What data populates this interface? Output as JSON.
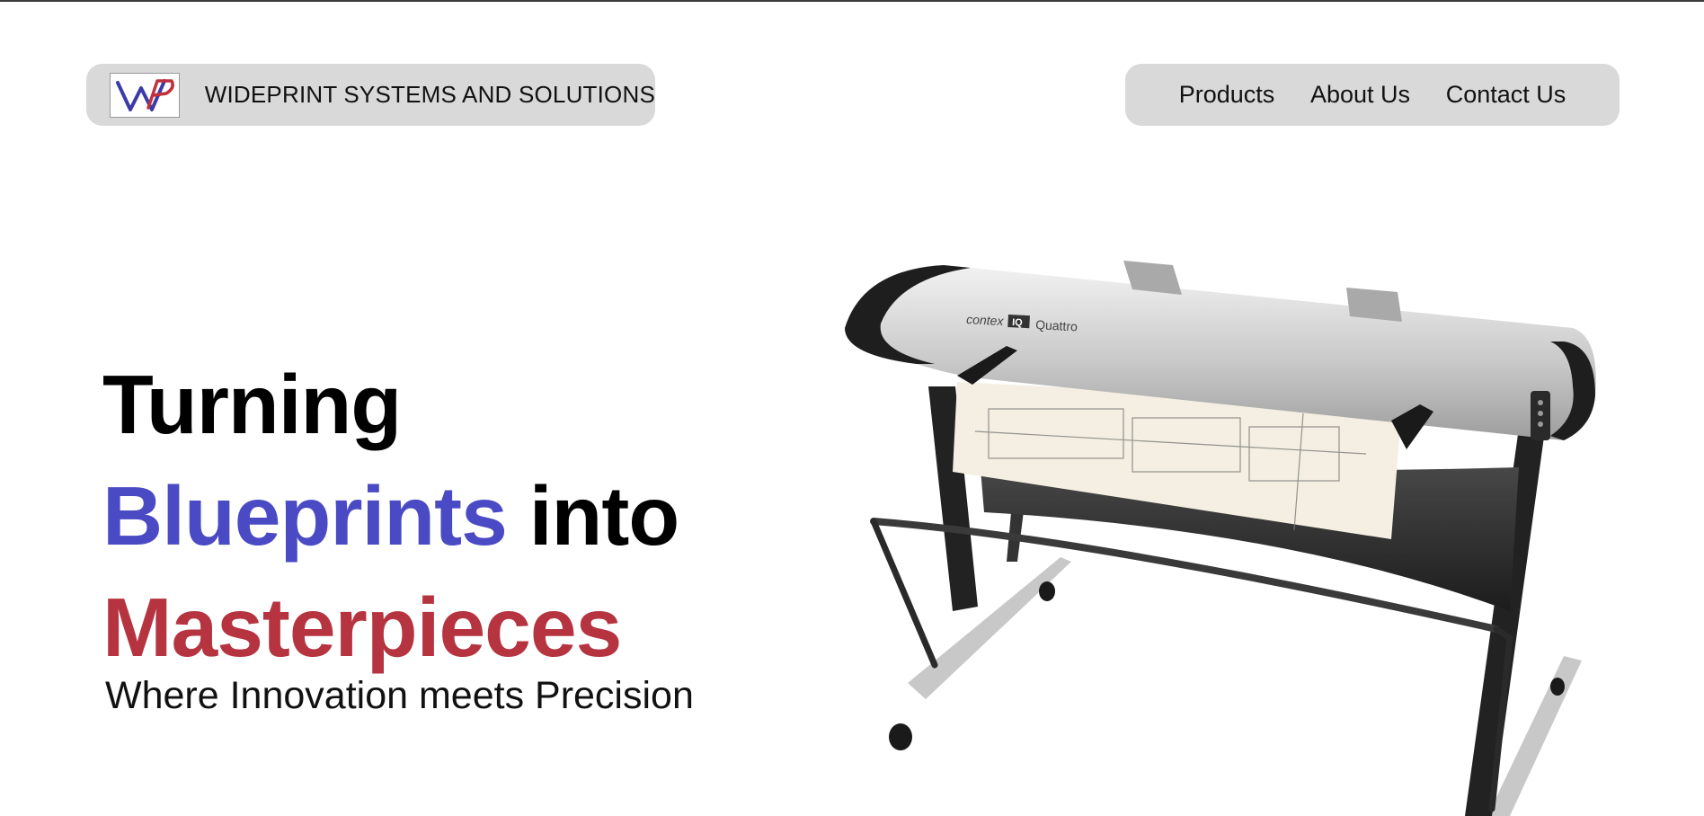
{
  "header": {
    "logo_text": "WP",
    "brand_name": "WIDEPRINT SYSTEMS AND SOLUTIONS",
    "nav": [
      {
        "label": "Products"
      },
      {
        "label": "About Us"
      },
      {
        "label": "Contact Us"
      }
    ]
  },
  "hero": {
    "line1": "Turning",
    "line2_blue": "Blueprints",
    "line2_rest": "into",
    "line3": "Masterpieces",
    "subtitle": "Where Innovation meets Precision"
  },
  "product_image": {
    "brand_text": "contex",
    "model_badge": "IQ",
    "model_name": "Quattro"
  },
  "colors": {
    "accent_blue": "#4a4ac4",
    "accent_red": "#b53440",
    "pill_bg": "#d9d9d9"
  }
}
